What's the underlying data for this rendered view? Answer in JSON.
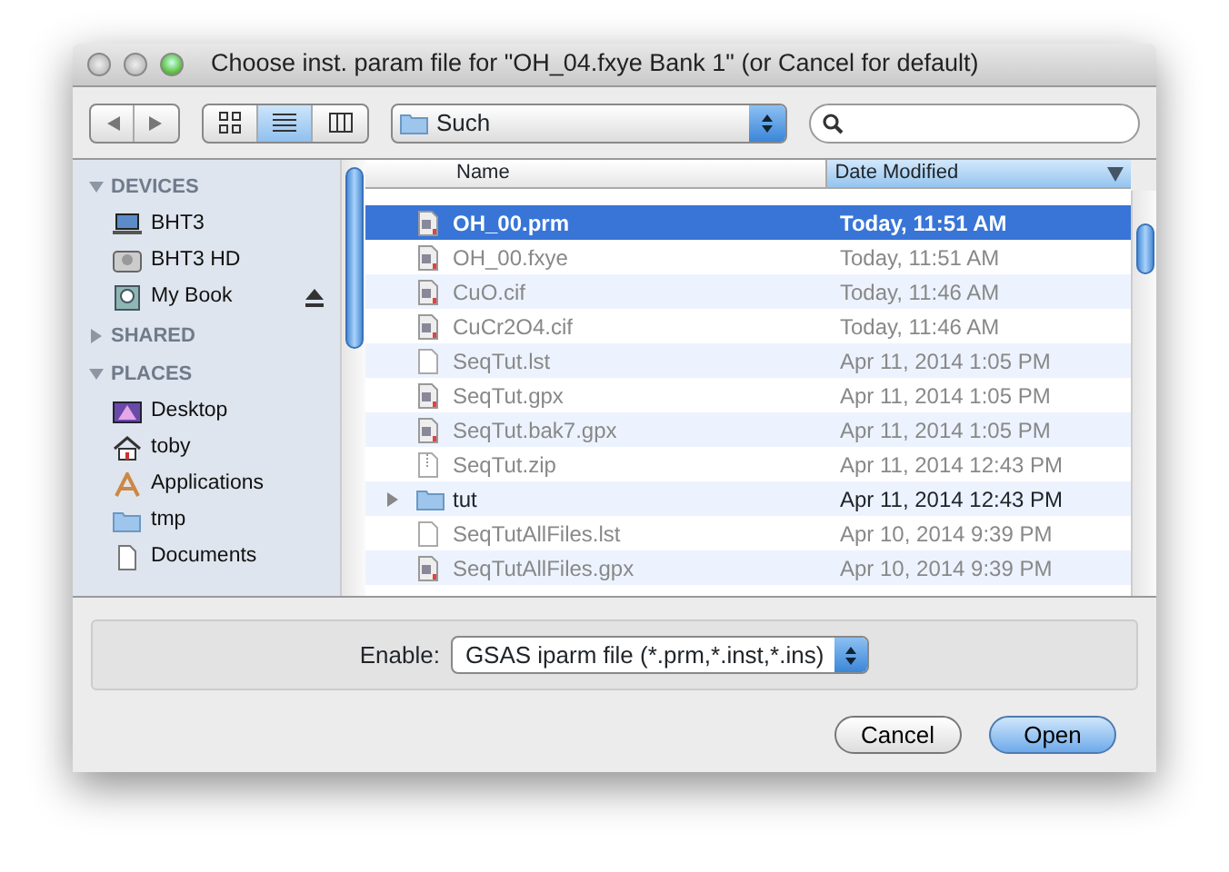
{
  "window": {
    "title": "Choose inst. param file for \"OH_04.fxye Bank 1\" (or Cancel for default)"
  },
  "toolbar": {
    "views": [
      {
        "selected": false
      },
      {
        "selected": true
      },
      {
        "selected": false
      }
    ],
    "location": "Such"
  },
  "sidebar": [
    {
      "label": "DEVICES",
      "expanded": true,
      "items": [
        {
          "label": "BHT3",
          "eject": false
        },
        {
          "label": "BHT3 HD",
          "eject": false
        },
        {
          "label": "My Book",
          "eject": true
        }
      ]
    },
    {
      "label": "SHARED",
      "expanded": false
    },
    {
      "label": "PLACES",
      "expanded": true,
      "items": [
        {
          "label": "Desktop",
          "eject": false
        },
        {
          "label": "toby",
          "eject": false
        },
        {
          "label": "Applications",
          "eject": false
        },
        {
          "label": "tmp",
          "eject": false
        },
        {
          "label": "Documents",
          "eject": false
        }
      ]
    }
  ],
  "table": {
    "columns": [
      {
        "label": "Name",
        "selected": false
      },
      {
        "label": "Date Modified",
        "selected": true
      }
    ],
    "rows": [
      {
        "name": "OH_00.prm",
        "date": "Today, 11:51 AM",
        "kind": "doc",
        "selected": true,
        "disabled": false
      },
      {
        "name": "OH_00.fxye",
        "date": "Today, 11:51 AM",
        "kind": "doc",
        "selected": false,
        "disabled": true
      },
      {
        "name": "CuO.cif",
        "date": "Today, 11:46 AM",
        "kind": "doc",
        "selected": false,
        "disabled": true
      },
      {
        "name": "CuCr2O4.cif",
        "date": "Today, 11:46 AM",
        "kind": "doc",
        "selected": false,
        "disabled": true
      },
      {
        "name": "SeqTut.lst",
        "date": "Apr 11, 2014 1:05 PM",
        "kind": "plain",
        "selected": false,
        "disabled": true
      },
      {
        "name": "SeqTut.gpx",
        "date": "Apr 11, 2014 1:05 PM",
        "kind": "doc",
        "selected": false,
        "disabled": true
      },
      {
        "name": "SeqTut.bak7.gpx",
        "date": "Apr 11, 2014 1:05 PM",
        "kind": "doc",
        "selected": false,
        "disabled": true
      },
      {
        "name": "SeqTut.zip",
        "date": "Apr 11, 2014 12:43 PM",
        "kind": "zip",
        "selected": false,
        "disabled": true
      },
      {
        "name": "tut",
        "date": "Apr 11, 2014 12:43 PM",
        "kind": "folder",
        "selected": false,
        "disabled": false,
        "expanded": false
      },
      {
        "name": "SeqTutAllFiles.lst",
        "date": "Apr 10, 2014 9:39 PM",
        "kind": "plain",
        "selected": false,
        "disabled": true
      },
      {
        "name": "SeqTutAllFiles.gpx",
        "date": "Apr 10, 2014 9:39 PM",
        "kind": "doc",
        "selected": false,
        "disabled": true
      }
    ]
  },
  "filter": {
    "label": "Enable:",
    "value": "GSAS iparm file (*.prm,*.inst,*.ins)"
  },
  "buttons": [
    {
      "label": "Cancel",
      "default": false
    },
    {
      "label": "Open",
      "default": true
    }
  ]
}
